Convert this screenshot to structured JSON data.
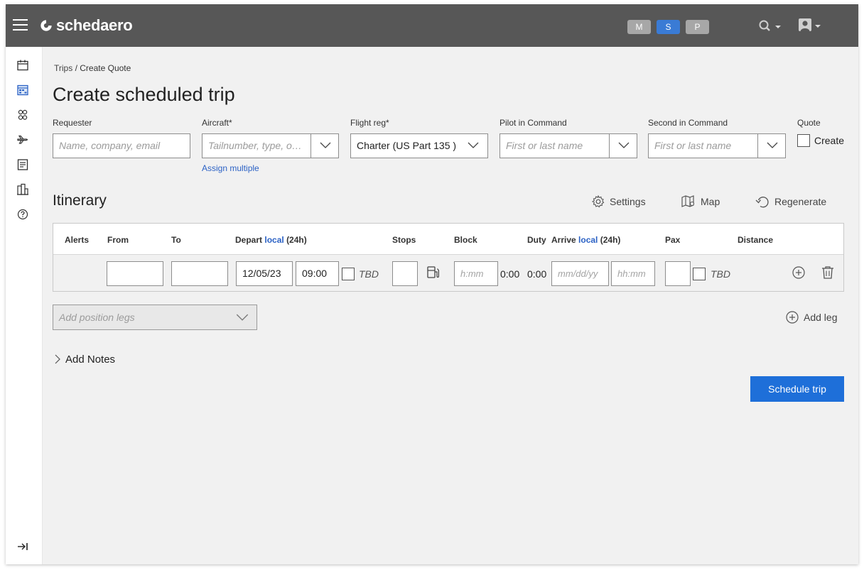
{
  "app": {
    "name": "schedaero",
    "brand_color": "#575757",
    "accent_color": "#1e6fd9"
  },
  "topbar": {
    "env_pills": [
      "M",
      "S",
      "P"
    ],
    "active_pill": "S",
    "icons": [
      "menu-icon",
      "search-icon",
      "user-icon"
    ]
  },
  "sidebar": {
    "items": [
      {
        "name": "calendar-icon"
      },
      {
        "name": "schedule-board-icon"
      },
      {
        "name": "crew-icon"
      },
      {
        "name": "aircraft-icon"
      },
      {
        "name": "reports-icon"
      },
      {
        "name": "buildings-icon"
      },
      {
        "name": "help-icon"
      }
    ],
    "collapse_icon": "collapse-icon"
  },
  "breadcrumb": {
    "parent": "Trips",
    "separator": "/",
    "current": "Create Quote"
  },
  "page": {
    "title": "Create scheduled trip"
  },
  "form": {
    "requester": {
      "label": "Requester",
      "placeholder": "Name, company, email"
    },
    "aircraft": {
      "label": "Aircraft*",
      "placeholder": "Tailnumber, type, o…",
      "assign_link": "Assign multiple"
    },
    "flight_reg": {
      "label": "Flight reg*",
      "value": "Charter (US Part 135 )"
    },
    "pic": {
      "label": "Pilot in Command",
      "placeholder": "First or last name"
    },
    "sic": {
      "label": "Second in Command",
      "placeholder": "First or last name"
    },
    "quote": {
      "label": "Quote",
      "checkbox_label": "Create",
      "checked": false
    }
  },
  "itinerary": {
    "title": "Itinerary",
    "tools": {
      "settings": "Settings",
      "map": "Map",
      "regenerate": "Regenerate"
    },
    "columns": {
      "alerts": "Alerts",
      "from": "From",
      "to": "To",
      "depart_prefix": "Depart",
      "depart_local": "local",
      "depart_suffix": "(24h)",
      "stops": "Stops",
      "block": "Block",
      "duty": "Duty",
      "arrive_prefix": "Arrive",
      "arrive_local": "local",
      "arrive_suffix": "(24h)",
      "pax": "Pax",
      "distance": "Distance"
    },
    "row": {
      "from": "",
      "to": "",
      "depart_date": "12/05/23",
      "depart_time": "09:00",
      "depart_tbd": "TBD",
      "stops": "",
      "block_placeholder": "h:mm",
      "block_value": "0:00",
      "duty_value": "0:00",
      "arrive_date_placeholder": "mm/dd/yy",
      "arrive_time_placeholder": "hh:mm",
      "pax": "",
      "pax_tbd": "TBD"
    },
    "position_legs_placeholder": "Add position legs",
    "add_leg": "Add leg"
  },
  "notes": {
    "label": "Add Notes"
  },
  "actions": {
    "schedule_trip": "Schedule trip"
  }
}
